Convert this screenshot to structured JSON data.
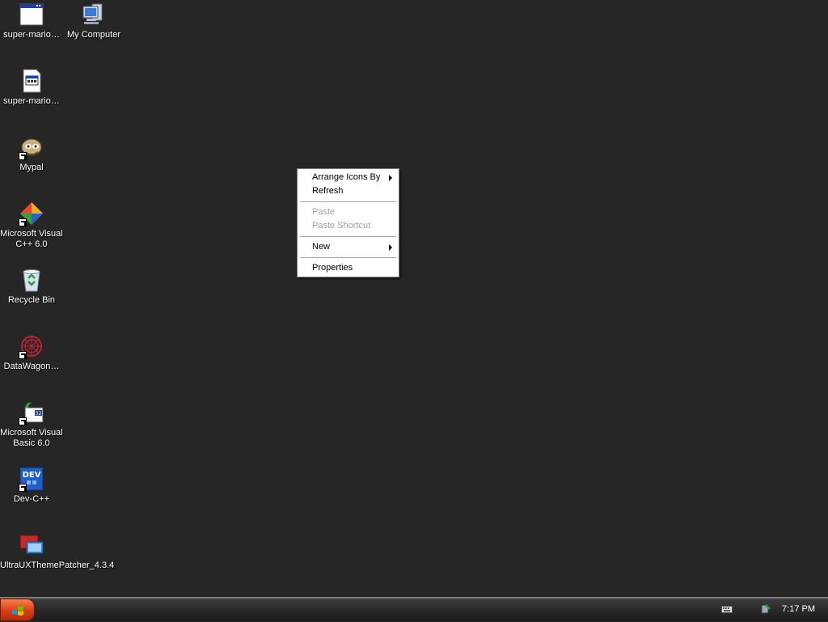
{
  "desktop": {
    "background": "#262626",
    "icons": [
      {
        "label": "super-mario…",
        "icon": "window-app-icon"
      },
      {
        "label": "My Computer",
        "icon": "my-computer-icon"
      },
      {
        "label": "super-mario…",
        "icon": "exe-file-icon"
      },
      {
        "label": "Mypal",
        "icon": "mypal-icon"
      },
      {
        "label": "Microsoft Visual C++ 6.0",
        "icon": "visual-cpp-icon"
      },
      {
        "label": "Recycle Bin",
        "icon": "recycle-bin-icon"
      },
      {
        "label": "DataWagon…",
        "icon": "datawagon-icon"
      },
      {
        "label": "Microsoft Visual Basic 6.0",
        "icon": "visual-basic-icon"
      },
      {
        "label": "Dev-C++",
        "icon": "dev-cpp-icon"
      },
      {
        "label": "UltraUXThemePatcher_4.3.4",
        "icon": "ultrauxthemepatcher-icon"
      }
    ]
  },
  "context_menu": {
    "arrange_icons_by": "Arrange Icons By",
    "refresh": "Refresh",
    "paste": "Paste",
    "paste_shortcut": "Paste Shortcut",
    "new": "New",
    "properties": "Properties"
  },
  "taskbar": {
    "start_color": "#d9431a",
    "clock": "7:17 PM"
  },
  "icons_text": {
    "dev": "DEV",
    "vb_badge": "32"
  }
}
